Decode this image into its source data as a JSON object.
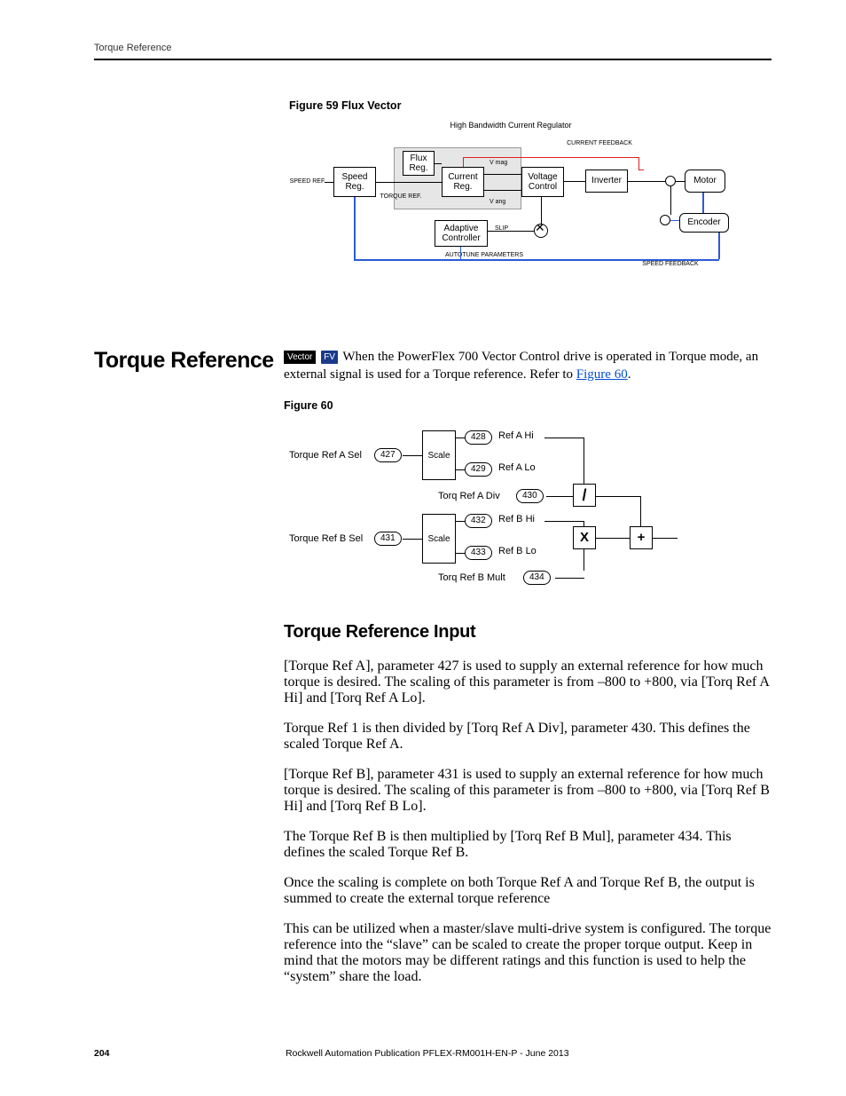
{
  "runningHead": "Torque Reference",
  "fig59": {
    "caption": "Figure 59   Flux Vector",
    "topLabel": "High Bandwidth Current Regulator",
    "speedRefLabel": "SPEED REF.",
    "torqueRefLabel": "TORQUE REF.",
    "currentFeedback": "CURRENT FEEDBACK",
    "speedFeedback": "SPEED FEEDBACK",
    "autotune": "AUTOTUNE PARAMETERS",
    "vmag": "V mag",
    "vang": "V ang",
    "slip": "SLIP",
    "blocks": {
      "speedReg": "Speed Reg.",
      "fluxReg": "Flux Reg.",
      "currentReg": "Current Reg.",
      "voltageControl": "Voltage Control",
      "inverter": "Inverter",
      "motor": "Motor",
      "adaptive": "Adaptive Controller",
      "encoder": "Encoder"
    }
  },
  "sideHead": "Torque Reference",
  "vectorTag": "Vector",
  "fvTag": "FV",
  "introText1": " When the PowerFlex 700 Vector Control drive is operated in Torque mode, an external signal is used for a Torque reference. Refer to ",
  "introLink": "Figure 60",
  "fig60": {
    "caption": "Figure 60",
    "labels": {
      "torqueRefASel": "Torque Ref A Sel",
      "torqueRefBSel": "Torque Ref B Sel",
      "refAHi": "Ref A Hi",
      "refALo": "Ref A Lo",
      "refBHi": "Ref B Hi",
      "refBLo": "Ref B Lo",
      "torqRefADiv": "Torq Ref A Div",
      "torqRefBMult": "Torq Ref B Mult",
      "scale": "Scale"
    },
    "params": {
      "p427": "427",
      "p428": "428",
      "p429": "429",
      "p430": "430",
      "p431": "431",
      "p432": "432",
      "p433": "433",
      "p434": "434"
    },
    "ops": {
      "div": "/",
      "mul": "X",
      "add": "+"
    }
  },
  "subhead": "Torque Reference Input",
  "p1": "[Torque Ref A], parameter 427 is used to supply an external reference for how much torque is desired. The scaling of this parameter is from –800 to +800, via [Torq Ref A Hi] and [Torq Ref A Lo].",
  "p2": "Torque Ref 1 is then divided by [Torq Ref A Div], parameter 430. This defines the scaled Torque Ref A.",
  "p3": "[Torque Ref B], parameter 431 is used to supply an external reference for how much torque is desired. The scaling of this parameter is from –800 to +800, via [Torq Ref B Hi] and [Torq Ref B Lo].",
  "p4": "The Torque Ref B is then multiplied by [Torq Ref B Mul], parameter 434. This defines the scaled Torque Ref B.",
  "p5": "Once the scaling is complete on both Torque Ref A and Torque Ref B, the output is summed to create the external torque reference",
  "p6": "This can be utilized when a master/slave multi-drive system is configured. The torque reference into the “slave” can be scaled to create the proper torque output. Keep in mind that the motors may be different ratings and this function is used to help the “system” share the load.",
  "footer": {
    "page": "204",
    "pub": "Rockwell Automation Publication PFLEX-RM001H-EN-P - June 2013"
  }
}
